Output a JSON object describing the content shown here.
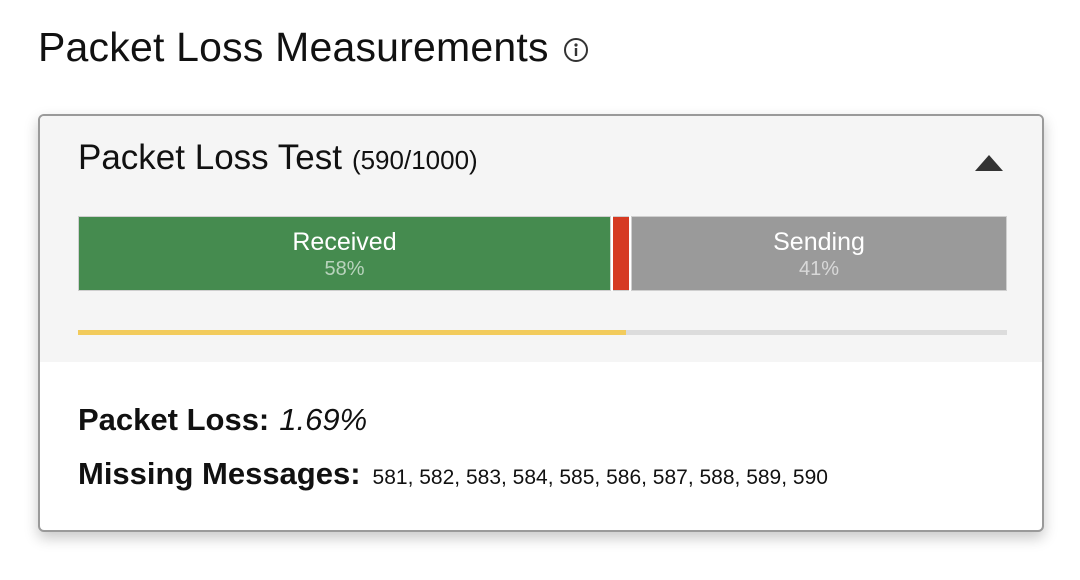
{
  "header": {
    "title": "Packet Loss Measurements",
    "info_icon": "info-circle-icon"
  },
  "test": {
    "name": "Packet Loss Test",
    "count": "(590/1000)",
    "toggle_icon": "triangle-up-icon",
    "bar": {
      "received_label": "Received",
      "received_pct": "58%",
      "sending_label": "Sending",
      "sending_pct": "41%",
      "received_fraction": 0.58,
      "lost_fraction": 0.0169,
      "sending_fraction": 0.41
    },
    "progress_fraction": 0.59,
    "colors": {
      "received": "#458b4f",
      "lost": "#d63a22",
      "sending": "#9a9a9a",
      "progress": "#f2cb5c"
    }
  },
  "stats": {
    "packet_loss_label": "Packet Loss:",
    "packet_loss_value": "1.69%",
    "missing_label": "Missing Messages:",
    "missing_value": "581, 582, 583, 584, 585, 586, 587, 588, 589, 590"
  }
}
